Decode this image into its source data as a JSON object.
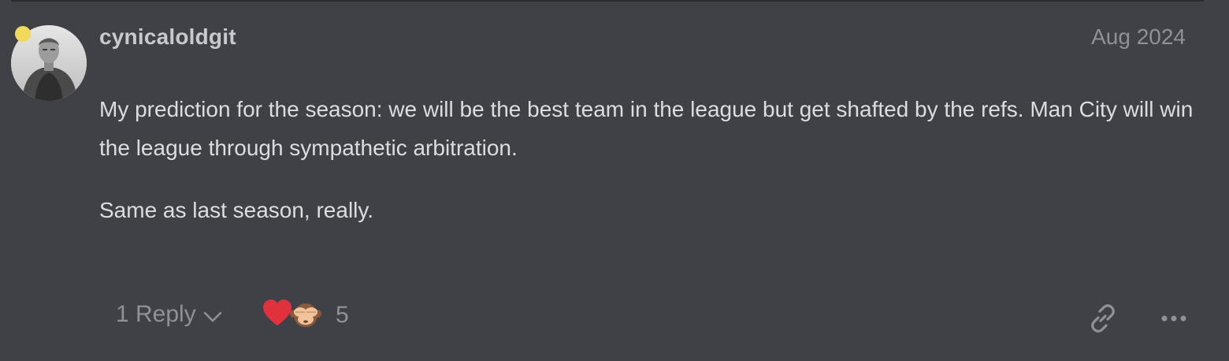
{
  "post": {
    "username": "cynicaloldgit",
    "date": "Aug 2024",
    "paragraphs": [
      "My prediction for the season: we will be the best team in the league but get shafted by the refs. Man City will win the league through sympathetic arbitration.",
      "Same as last season, really."
    ]
  },
  "controls": {
    "reply_label": "1 Reply",
    "reaction_count": "5",
    "reactions": [
      "heart",
      "see-no-evil-monkey"
    ]
  },
  "colors": {
    "background": "#3f4146",
    "status_dot": "#f1d95b",
    "heart": "#e0323c"
  }
}
